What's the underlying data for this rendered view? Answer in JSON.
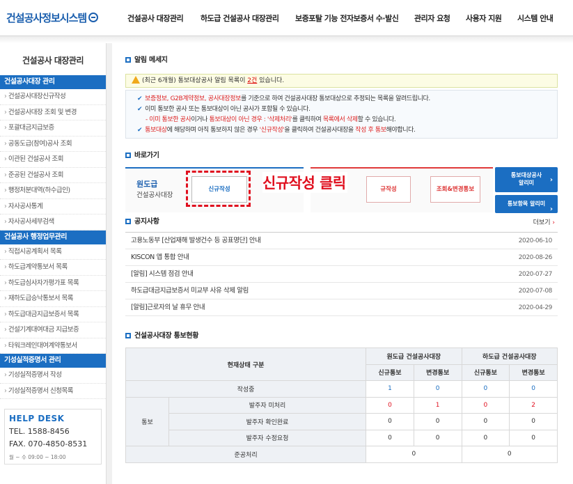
{
  "header": {
    "logo": "건설공사정보시스템",
    "nav": [
      "건설공사 대장관리",
      "하도급 건설공사 대장관리",
      "보증포탈 기능 전자보증서 수·발신",
      "관리자 요청",
      "사용자 지원",
      "시스템 안내"
    ]
  },
  "sidebar": {
    "title": "건설공사 대장관리",
    "cat1": "건설공사대장 관리",
    "cat1_items": [
      "건설공사대장신규작성",
      "건설공사대장 조회 및 변경",
      "포괄대금지급보증",
      "공동도급(참여)공사 조회",
      "이관된 건설공사 조회",
      "준공된 건설공사 조회",
      "행정처분대역(하수급인)",
      "자사공사통계",
      "자사공사세부검색"
    ],
    "cat2": "건설공사 행정업무관리",
    "cat2_items": [
      "직접시공계획서 목록",
      "하도급계약통보서 목록",
      "하도급심사자가평가표 목록",
      "재하도급승낙통보서 목록",
      "하도급대금지급보증서 목록",
      "건설기계대여대금 지급보증",
      "타워크레인대여계약통보서"
    ],
    "cat3": "기성실적증명서 관리",
    "cat3_items": [
      "기성실적증명서 작성",
      "기성실적증명서 신청목록"
    ],
    "helpdesk": {
      "title": "HELP DESK",
      "tel": "TEL. 1588-8456",
      "fax": "FAX. 070-4850-8531",
      "hours": "월 ~ 수   09:00 ~ 18:00"
    }
  },
  "alert": {
    "title": "알림 메세지",
    "msg_before": "(최근 6개월) 통보대상공사 알림 목록이 ",
    "count": "2건",
    "msg_after": " 있습니다."
  },
  "notes": {
    "n1_hl": "보증정보, G2B계약정보, 공사대장정보",
    "n1_rest": "를 기준으로 하여 건설공사대장 통보대상으로 추정되는 목록을 알려드립니다.",
    "n2": "이미 통보한 공사 또는 통보대상이 아닌 공사가 포함될 수 있습니다.",
    "n3_a": "- 이미 통보한 공사",
    "n3_b": "이거나 ",
    "n3_c": "통보대상이 아닌 경우 : '삭제처리'",
    "n3_d": "를 클릭하여 ",
    "n3_e": "목록에서 삭제",
    "n3_f": "할 수 있습니다.",
    "n4_a": "통보대상",
    "n4_b": "에 해당하며 아직 통보하지 않은 경우 ",
    "n4_c": "'신규작성'",
    "n4_d": "을 클릭하여 건설공사대장을 ",
    "n4_e": "작성 후 통보",
    "n4_f": "해야합니다."
  },
  "quick": {
    "title": "바로가기",
    "left_title": "원도급",
    "left_sub": "건설공사대장",
    "new_btn": "신규작성",
    "annotation": "신규작성 클릭",
    "right_new": "규작성",
    "right_query": "조회&변경통보",
    "blue1_line1": "통보대상공사",
    "blue1_line2": "알리미",
    "blue2": "통보항목 알리미"
  },
  "notice": {
    "title": "공지사항",
    "more": "더보기",
    "items": [
      {
        "title": "고용노동부 [산업재해 발생건수 등 공표명단] 안내",
        "date": "2020-06-10"
      },
      {
        "title": "KISCON 앱 통합 안내",
        "date": "2020-08-26"
      },
      {
        "title": "[알림] 시스템 점검 안내",
        "date": "2020-07-27"
      },
      {
        "title": "하도급대금지급보증서 미교부 사유 삭제 알림",
        "date": "2020-07-08"
      },
      {
        "title": "[알림]근로자의 날 휴무 안내",
        "date": "2020-04-29"
      }
    ]
  },
  "status": {
    "title": "건설공사대장 통보현황",
    "h_state": "현재상태 구분",
    "h_orig": "원도급 건설공사대장",
    "h_sub": "하도급 건설공사대장",
    "h_new": "신규통보",
    "h_change": "변경통보",
    "r_writing": "작성중",
    "r_writing_vals": [
      "1",
      "0",
      "0",
      "0"
    ],
    "r_notify": "통보",
    "r_unproc": "발주자 미처리",
    "r_unproc_vals": [
      "0",
      "1",
      "0",
      "2"
    ],
    "r_confirm": "발주자 확인완료",
    "r_confirm_vals": [
      "0",
      "0",
      "0",
      "0"
    ],
    "r_modreq": "발주자 수정요청",
    "r_modreq_vals": [
      "0",
      "0",
      "0",
      "0"
    ],
    "r_done": "준공처리",
    "r_done_vals": [
      "0",
      "0"
    ]
  }
}
